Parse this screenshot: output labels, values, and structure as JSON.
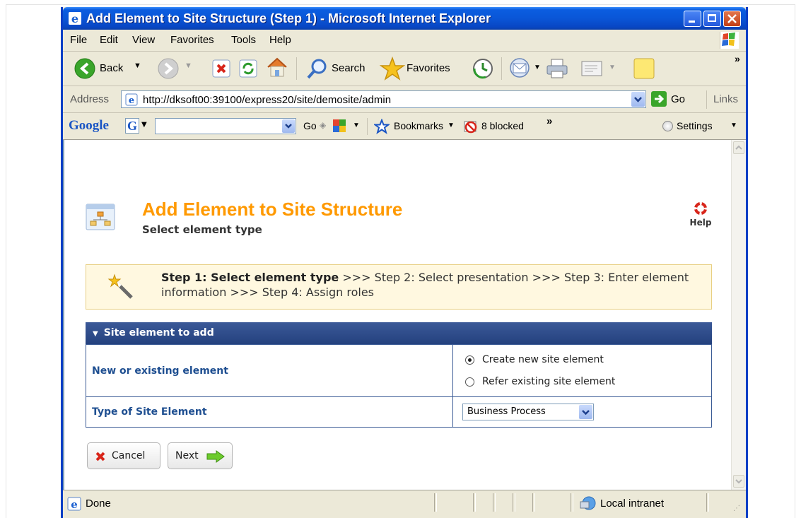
{
  "window": {
    "title": "Add Element to Site Structure (Step 1) - Microsoft Internet Explorer"
  },
  "menu": [
    "File",
    "Edit",
    "View",
    "Favorites",
    "Tools",
    "Help"
  ],
  "toolbar": {
    "back": "Back",
    "search": "Search",
    "favorites": "Favorites"
  },
  "address": {
    "label": "Address",
    "url": "http://dksoft00:39100/express20/site/demosite/admin",
    "go": "Go",
    "links": "Links"
  },
  "google_bar": {
    "logo": "Google",
    "go": "Go",
    "bookmarks": "Bookmarks",
    "blocked": "8 blocked",
    "settings": "Settings",
    "chevron": "»"
  },
  "page": {
    "title": "Add Element to Site Structure",
    "subtitle": "Select element type",
    "help": "Help",
    "wizard": {
      "current": "Step 1: Select element type",
      "rest": ">>> Step 2: Select presentation >>> Step 3: Enter element information >>> Step 4: Assign roles"
    },
    "panel": {
      "header": "Site element to add",
      "row1_label": "New or existing element",
      "radio_new": "Create new site element",
      "radio_existing": "Refer existing site element",
      "row2_label": "Type of Site Element",
      "select_value": "Business Process"
    },
    "cancel": "Cancel",
    "next": "Next"
  },
  "status": {
    "text": "Done",
    "zone": "Local intranet"
  },
  "colors": {
    "title_orange": "#ff9900",
    "panel_header": "#2e4a86",
    "label_blue": "#1f4f91",
    "xp_blue": "#0a56d7"
  }
}
